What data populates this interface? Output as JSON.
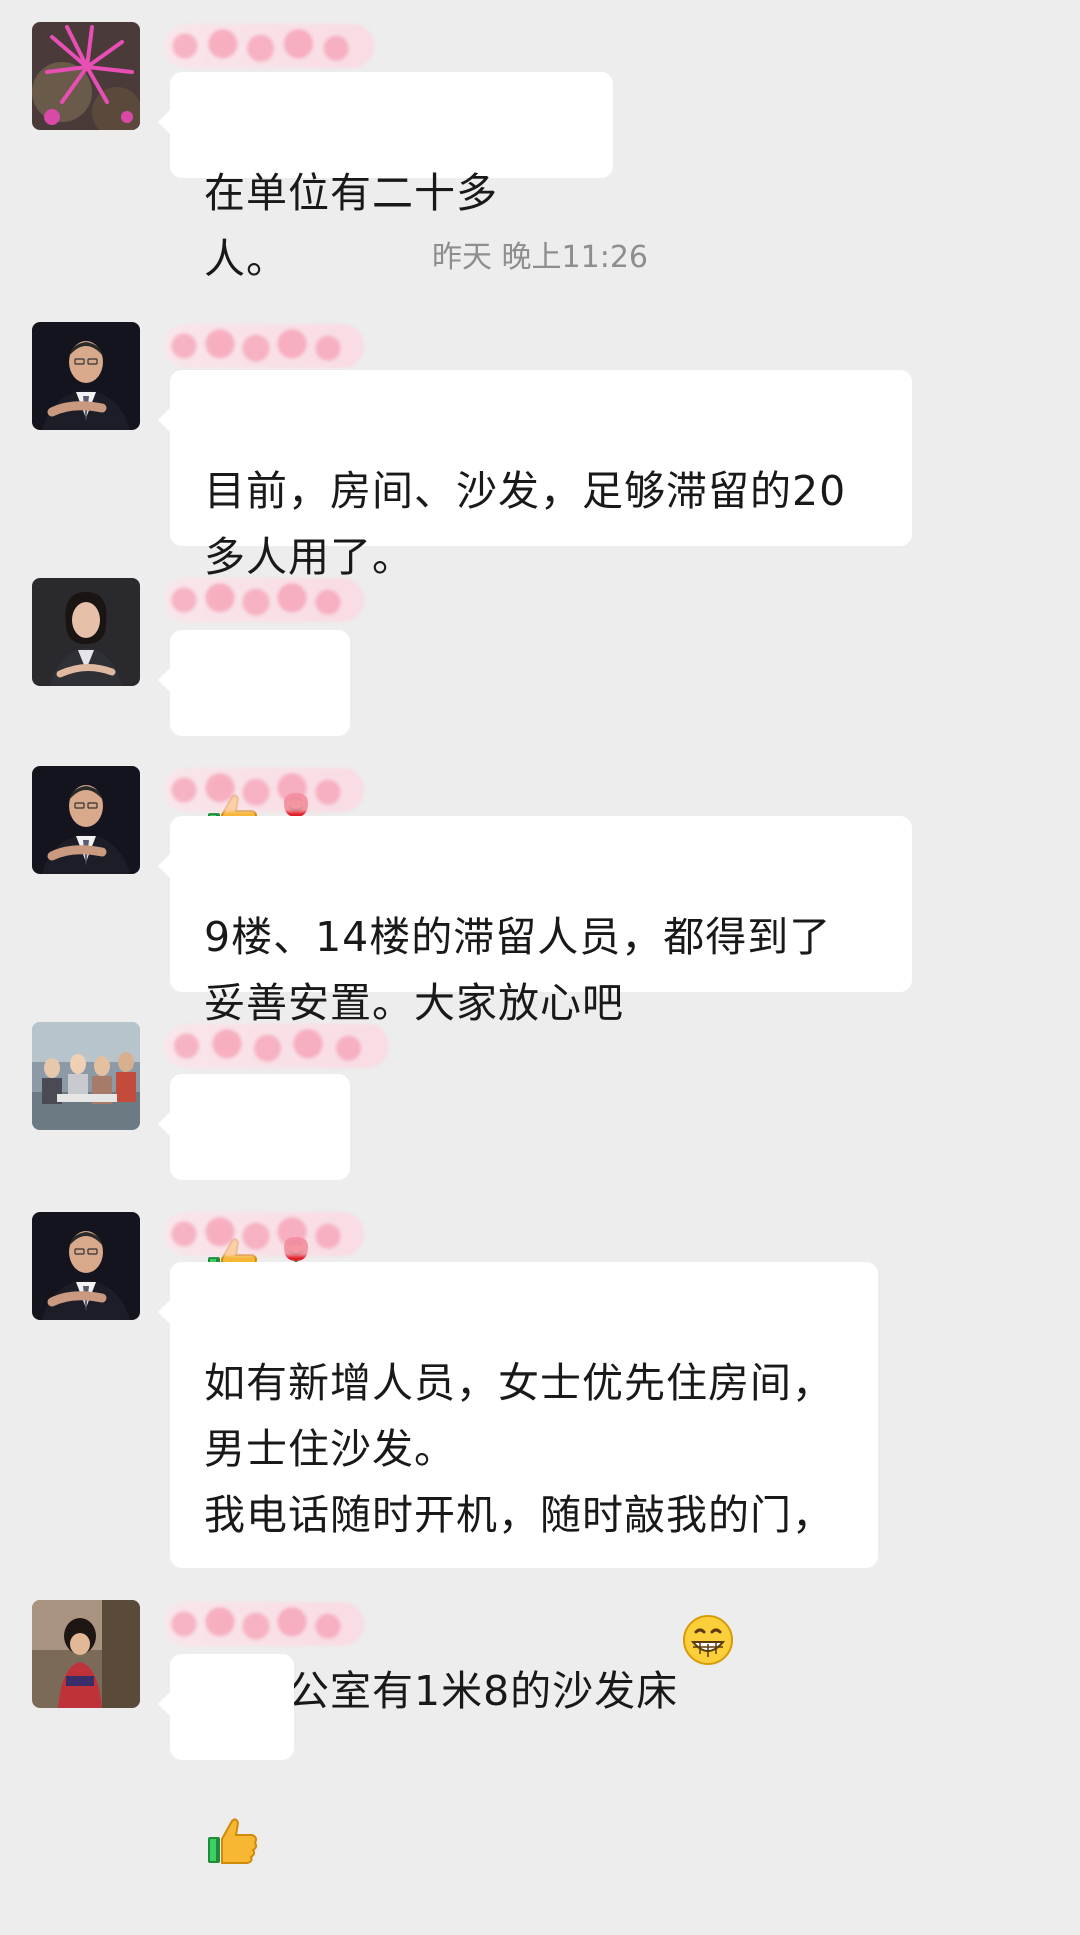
{
  "timestamp": "昨天 晚上11:26",
  "messages": [
    {
      "avatar": "pink-flower-avatar",
      "text": "在单位有二十多人。"
    },
    {
      "avatar": "man-in-suit-avatar",
      "text": "目前，房间、沙发，足够滞留的20\n多人用了。"
    },
    {
      "avatar": "woman-in-suit-avatar",
      "emojis": [
        "thumbs-up-icon",
        "rose-icon"
      ]
    },
    {
      "avatar": "man-in-suit-avatar",
      "text": "9楼、14楼的滞留人员，都得到了\n妥善安置。大家放心吧"
    },
    {
      "avatar": "group-photo-avatar",
      "emojis": [
        "thumbs-up-icon",
        "rose-icon"
      ]
    },
    {
      "avatar": "man-in-suit-avatar",
      "text": "如有新增人员，女士优先住房间，\n男士住沙发。\n我电话随时开机，随时敲我的门，\n我办公室有1米8的沙发床",
      "trailing_emoji": "grinning-face-icon"
    },
    {
      "avatar": "child-photo-avatar",
      "emojis": [
        "thumbs-up-icon"
      ]
    }
  ]
}
